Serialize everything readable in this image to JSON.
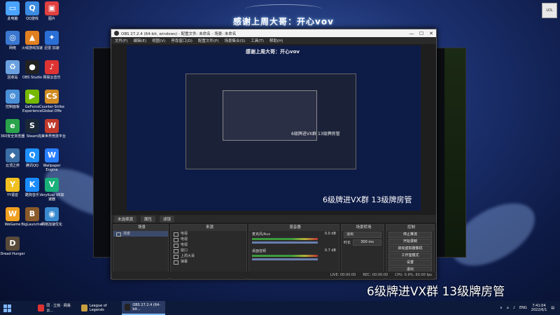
{
  "banner": {
    "title": "感谢上周大哥：开心vov"
  },
  "corner_logo": "LOL",
  "desktop_icons": [
    {
      "label": "此电脑",
      "color": "#4aa3ff",
      "glyph": "▭"
    },
    {
      "label": "QQ游戏",
      "color": "#3b8be0",
      "glyph": "Q"
    },
    {
      "label": "图片",
      "color": "#e04040",
      "glyph": "▣"
    },
    {
      "label": "网络",
      "color": "#3a77d0",
      "glyph": "◎"
    },
    {
      "label": "火绒游戏加速",
      "color": "#e08020",
      "glyph": "▲"
    },
    {
      "label": "迅雷 加速",
      "color": "#2a6fd6",
      "glyph": "✦"
    },
    {
      "label": "回收站",
      "color": "#6aa0e0",
      "glyph": "♻"
    },
    {
      "label": "OBS Studio",
      "color": "#222",
      "glyph": "●"
    },
    {
      "label": "网易云音乐",
      "color": "#d33",
      "glyph": "♪"
    },
    {
      "label": "控制面板",
      "color": "#4a90d9",
      "glyph": "⚙"
    },
    {
      "label": "GeForce Experience",
      "color": "#76b900",
      "glyph": "▶"
    },
    {
      "label": "Counter-Strike Global Offe",
      "color": "#d08a20",
      "glyph": "CS"
    },
    {
      "label": "360安全浏览器",
      "color": "#2aa34a",
      "glyph": "e"
    },
    {
      "label": "Steam",
      "color": "#1b2838",
      "glyph": "S"
    },
    {
      "label": "完美世界竞技平台",
      "color": "#c0392b",
      "glyph": "W"
    },
    {
      "label": "云顶之弈",
      "color": "#3a6ea5",
      "glyph": "◆"
    },
    {
      "label": "腾讯QQ",
      "color": "#1e90ff",
      "glyph": "Q"
    },
    {
      "label": "Wallpaper Engine",
      "color": "#2a7fff",
      "glyph": "W"
    },
    {
      "label": "YY语音",
      "color": "#f0c020",
      "glyph": "Y"
    },
    {
      "label": "酷狗音乐",
      "color": "#1a8cff",
      "glyph": "K"
    },
    {
      "label": "VeryKuai VK加速器",
      "color": "#19b07a",
      "glyph": "V"
    },
    {
      "label": "WeGame",
      "color": "#f0a020",
      "glyph": "W"
    },
    {
      "label": "BigLauncher",
      "color": "#8a5a2a",
      "glyph": "B"
    },
    {
      "label": "网络加速优化",
      "color": "#3a8ad0",
      "glyph": "◉"
    },
    {
      "label": "Dread Hunger",
      "color": "#5a4a3a",
      "glyph": "D"
    }
  ],
  "obs": {
    "title": "OBS 27.2.4 (64-bit, windows) - 配置文件: 未命名 - 场景: 未命名",
    "menus": [
      "文件(F)",
      "编辑(E)",
      "视图(V)",
      "停靠窗口(D)",
      "配置文件(P)",
      "场景集合(S)",
      "工具(T)",
      "帮助(H)"
    ],
    "window_controls": [
      "—",
      "☐",
      "✕"
    ],
    "preview_caption": "6级牌进VX群  13级牌房管",
    "inner_caption": "6级牌进VX群  13级牌房管",
    "inner_title": "感谢上周大哥：开心vov",
    "dock_tabs": [
      "未选择源",
      "属性",
      "滤镜"
    ],
    "scenes": {
      "header": "场景",
      "items": [
        "场景"
      ]
    },
    "sources": {
      "header": "来源",
      "items": [
        "电视",
        "电视",
        "电视",
        "窗口",
        "上周大哥",
        "弹幕"
      ]
    },
    "mixer": {
      "header": "混音器",
      "channels": [
        {
          "name": "麦克风/Aux",
          "db": "0.0 dB"
        },
        {
          "name": "桌面音频",
          "db": "0.7 dB"
        }
      ]
    },
    "transitions": {
      "header": "场景转场",
      "type": "淡出",
      "duration_label": "时长",
      "duration": "300 ms"
    },
    "controls": {
      "header": "控制",
      "buttons": [
        "停止推流",
        "开始录制",
        "启动虚拟摄像机",
        "工作室模式",
        "设置",
        "退出"
      ]
    },
    "status": {
      "live": "LIVE: 00:00:00",
      "rec": "REC: 00:00:00",
      "cpu": "CPU: 0.9%, 60.00 fps"
    }
  },
  "overlay_caption": "6级牌进VX群  13级牌房管",
  "taskbar": {
    "items": [
      {
        "label": "同 · 立刻 · 网易云...",
        "color": "#d33",
        "active": false
      },
      {
        "label": "League of Legends",
        "color": "#c8a040",
        "active": false
      },
      {
        "label": "OBS 27.2.4 (64-bit...",
        "color": "#222",
        "active": true
      }
    ],
    "tray": {
      "lang": "ENG",
      "time": "7:41:04",
      "date": "2022/6/1"
    }
  }
}
